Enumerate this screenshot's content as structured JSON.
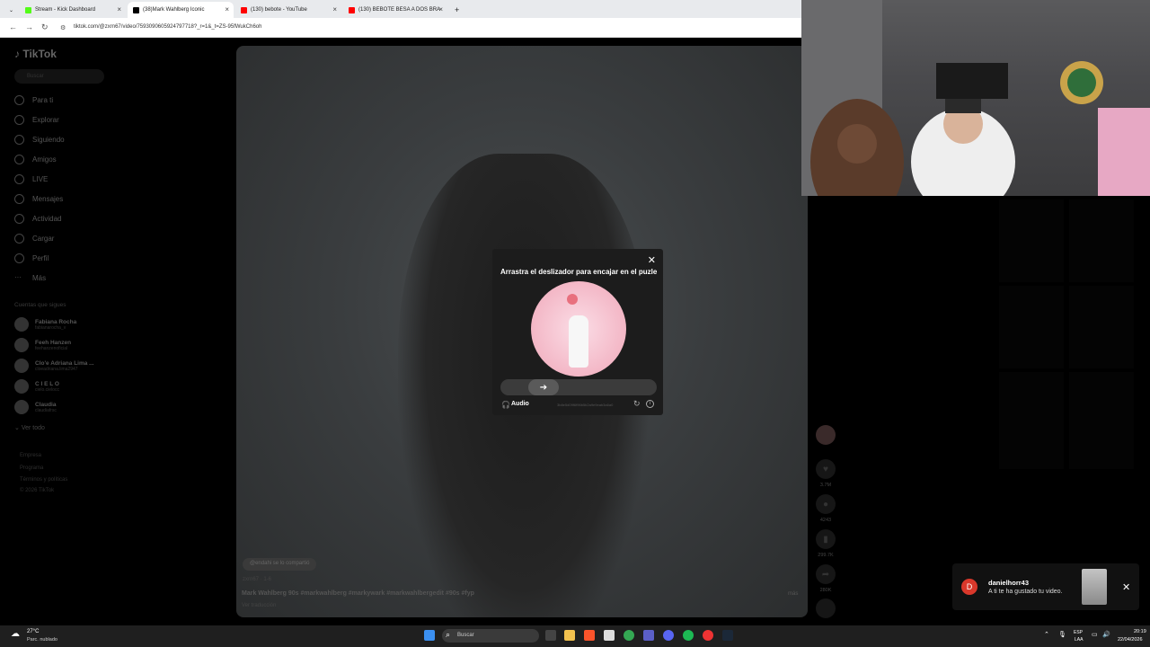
{
  "browser": {
    "tabs": [
      {
        "title": "Stream - Kick Dashboard",
        "color": "#53fc18"
      },
      {
        "title": "(38)Mark Wahlberg Iconic",
        "color": "#000000"
      },
      {
        "title": "(130) bebote - YouTube",
        "color": "#ff0000"
      },
      {
        "title": "(130) BEBOTE BESA A DOS BRA",
        "color": "#ff0000"
      }
    ],
    "url": "tiktok.com/@zxrn67/video/7593090605924797718?_r=1&_t=ZS-95fWukCh6oh"
  },
  "tiktok": {
    "logo": "TikTok",
    "search_placeholder": "Buscar",
    "nav": [
      "Para ti",
      "Explorar",
      "Siguiendo",
      "Amigos",
      "LIVE",
      "Mensajes",
      "Actividad",
      "Cargar",
      "Perfil",
      "Más"
    ],
    "following_title": "Cuentas que sigues",
    "accounts": [
      {
        "name": "Fabiana Rocha",
        "handle": "fabianarocha_v"
      },
      {
        "name": "Feeh Hanzen",
        "handle": "feehanzenoficial"
      },
      {
        "name": "Clo'e Adriana Lima ...",
        "handle": "cloeadriana.lima2947"
      },
      {
        "name": "C I E L O",
        "handle": "cielo.cielocc"
      },
      {
        "name": "Claudia",
        "handle": "claudiafrsc"
      }
    ],
    "see_all": "Ver todo",
    "footer": [
      "Empresa",
      "Programa",
      "Términos y políticas",
      "© 2026 TikTok"
    ],
    "video": {
      "mention": "@endahi se lo compartió",
      "date": "zxrn67 · 1-6",
      "description": "Mark Wahlberg 90s #markwahlberg #markywark #markwahlbergedit #90s #fyp",
      "translation": "Ver traducción",
      "more": "más"
    },
    "actions": [
      {
        "icon": "heart-icon",
        "value": "3.7M"
      },
      {
        "icon": "comment-icon",
        "value": "4243"
      },
      {
        "icon": "bookmark-icon",
        "value": "299.7K"
      },
      {
        "icon": "share-icon",
        "value": "280K"
      }
    ]
  },
  "captcha": {
    "title": "Arrastra el deslizador para encajar en el puzle",
    "audio_label": "Audio",
    "session_id": "3b8e5d09f6f96b5b2a9e9eab3a6a0",
    "slider_progress": 0.22
  },
  "notification": {
    "avatar_letter": "D",
    "user": "danielhorr43",
    "message": "A ti te ha gustado tu video."
  },
  "taskbar": {
    "weather_temp": "27°C",
    "weather_desc": "Parc. nublado",
    "search_label": "Buscar",
    "lang1": "ESP",
    "lang2": "LAA",
    "time": "20:19",
    "date": "22/04/2026"
  }
}
